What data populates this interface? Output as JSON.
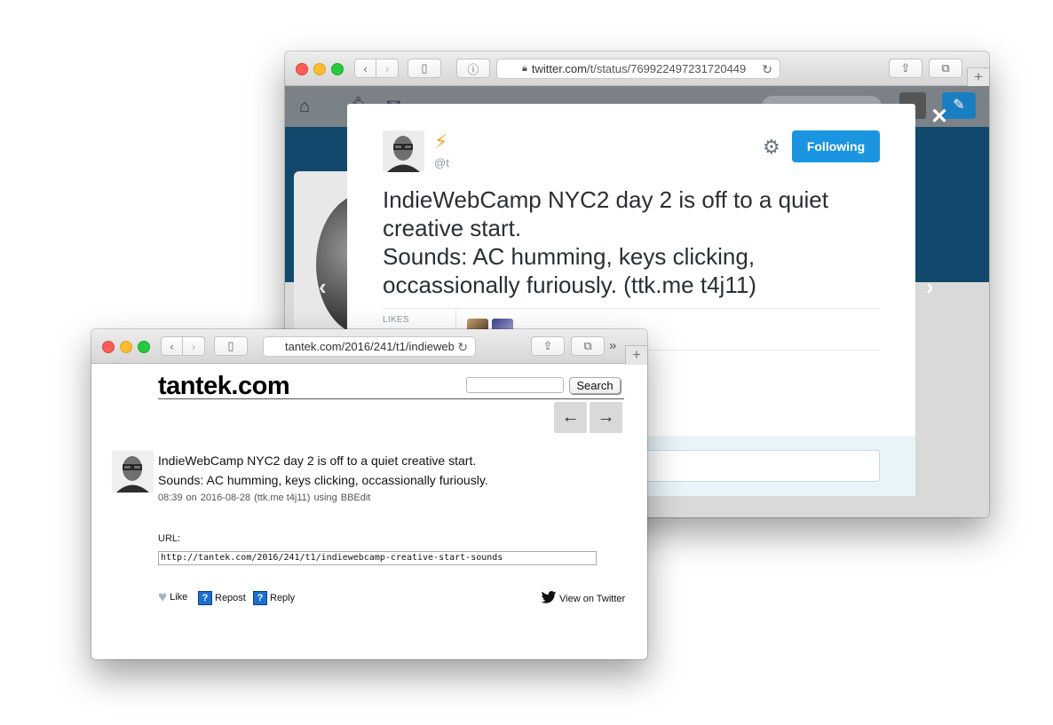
{
  "twitter_window": {
    "url_host": "twitter.com",
    "url_path": "/t/status/769922497231720449",
    "tweet": {
      "display_name_icon": "lightning-bolt-icon",
      "handle": "@t",
      "follow_button": "Following",
      "text_lines": [
        "IndieWebCamp NYC2 day 2 is off to a quiet creative start.",
        "Sounds: AC humming, keys clicking, occassionally furiously. (ttk.me t4j11)"
      ],
      "likes_label": "LIKES"
    },
    "colors": {
      "accent": "#1b95e0",
      "header": "#12486b"
    }
  },
  "site_window": {
    "url": "tantek.com/2016/241/t1/indieweb",
    "site_title": "tantek.com",
    "search_placeholder": "",
    "search_button": "Search",
    "prev_label": "←",
    "next_label": "→",
    "note": {
      "line1": "IndieWebCamp NYC2 day 2 is off to a quiet creative start.",
      "line2": "Sounds: AC humming, keys clicking, occassionally furiously.",
      "time": "08:39",
      "on": "on",
      "date": "2016-08-28",
      "shortlink": "(ttk.me t4j11)",
      "using": "using",
      "client": "BBEdit"
    },
    "url_label": "URL:",
    "permalink": "http://tantek.com/2016/241/t1/indiewebcamp-creative-start-sounds",
    "actions": {
      "like": "Like",
      "repost": "Repost",
      "reply": "Reply",
      "view_on_twitter": "View on Twitter"
    }
  }
}
